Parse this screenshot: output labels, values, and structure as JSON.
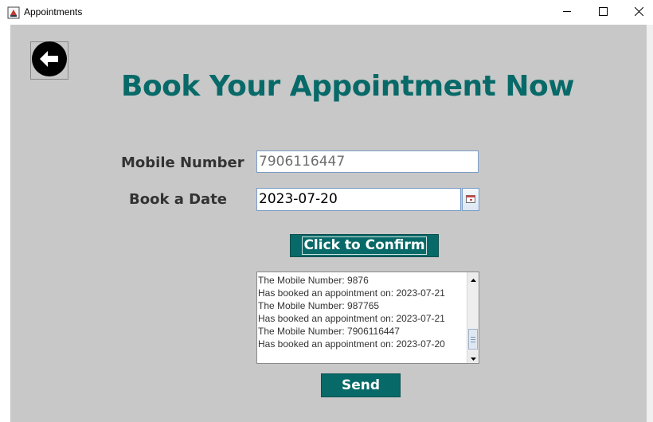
{
  "window": {
    "title": "Appointments",
    "icons": {
      "app": "java-cup-icon",
      "minimize": "minimize-icon",
      "maximize": "maximize-icon",
      "close": "close-icon"
    }
  },
  "page": {
    "heading": "Book Your Appointment Now",
    "back_icon": "arrow-left-circle-icon"
  },
  "form": {
    "mobile_label": "Mobile Number",
    "mobile_value": "7906116447",
    "date_label": "Book a Date",
    "date_value": "2023-07-20",
    "calendar_icon": "calendar-icon",
    "confirm_label": "Click to Confirm"
  },
  "log": {
    "lines": [
      "The Mobile Number: 9876",
      "Has booked an appointment on: 2023-07-21",
      "The Mobile Number: 987765",
      "Has booked an appointment on: 2023-07-21",
      "The Mobile Number: 7906116447",
      "Has booked an appointment on: 2023-07-20"
    ]
  },
  "send_label": "Send",
  "colors": {
    "accent": "#086a68",
    "background": "#c8c8c8",
    "label_text": "#333333"
  }
}
